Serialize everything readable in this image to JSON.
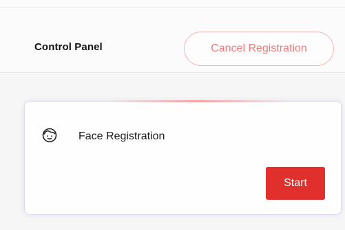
{
  "panel": {
    "title": "Control Panel",
    "cancel_label": "Cancel Registration"
  },
  "card": {
    "icon": "face-icon",
    "label": "Face Registration",
    "start_label": "Start"
  },
  "colors": {
    "accent_red": "#e1302b",
    "cancel_text": "#f07b7b",
    "cancel_border": "#f0b7b7",
    "card_border": "#dcd8ee"
  }
}
